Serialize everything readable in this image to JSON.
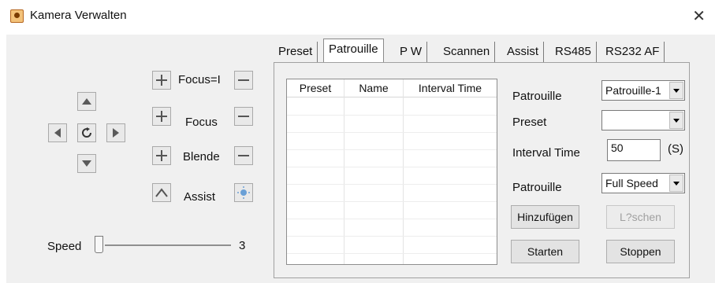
{
  "window": {
    "title": "Kamera Verwalten"
  },
  "ptz": {
    "up_icon": "arrow-up-icon",
    "down_icon": "arrow-down-icon",
    "left_icon": "arrow-left-icon",
    "right_icon": "arrow-right-icon",
    "center_icon": "refresh-icon"
  },
  "lens": {
    "focus_near_label": "Focus=I",
    "focus_label": "Focus",
    "iris_label": "Blende",
    "assist_label": "Assist"
  },
  "speed": {
    "label": "Speed",
    "value": "3",
    "level": 0.0
  },
  "tabs": [
    "Preset",
    "Patrouille",
    "P  W",
    "Scannen",
    "Assist",
    "RS485",
    "RS232  AF"
  ],
  "active_tab": "Patrouille",
  "table": {
    "columns": [
      "Preset",
      "Name",
      "Interval Time"
    ],
    "rows": []
  },
  "form": {
    "patrouille_label": "Patrouille",
    "patrouille_value": "Patrouille-1",
    "preset_label": "Preset",
    "preset_value": "",
    "interval_label": "Interval Time",
    "interval_value": "50",
    "interval_unit": "(S)",
    "speed_mode_label": "Patrouille",
    "speed_mode_value": "Full Speed"
  },
  "buttons": {
    "add": "Hinzufügen",
    "delete": "L?schen",
    "start": "Starten",
    "stop": "Stoppen"
  },
  "colors": {
    "accent": "#5b8fc7",
    "button_face": "#e9e9e9",
    "window_bg": "#f0f0f0"
  }
}
